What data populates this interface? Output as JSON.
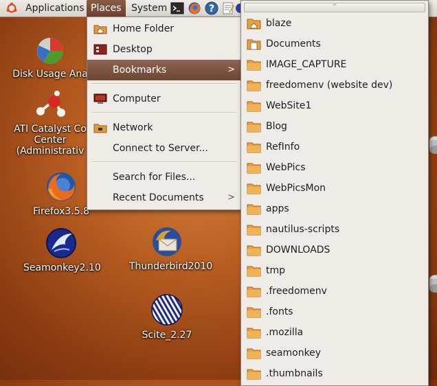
{
  "panel": {
    "applications": "Applications",
    "places": "Places",
    "system": "System"
  },
  "desktop": {
    "icons": [
      {
        "label1": "Disk Usage Ana",
        "label2": "",
        "label3": ""
      },
      {
        "label1": "ATI Catalyst Co",
        "label2": "Center",
        "label3": "(Administrativ"
      },
      {
        "label1": "Firefox3.5.8",
        "label2": "",
        "label3": ""
      },
      {
        "label1": "Seamonkey2.10",
        "label2": "",
        "label3": ""
      },
      {
        "label1": "Thunderbird2010",
        "label2": "",
        "label3": ""
      },
      {
        "label1": "Scite_2.27",
        "label2": "",
        "label3": ""
      }
    ]
  },
  "places_menu": {
    "items": [
      {
        "label": "Home Folder"
      },
      {
        "label": "Desktop"
      },
      {
        "label": "Bookmarks"
      },
      {
        "label": "Computer"
      },
      {
        "label": "Network"
      },
      {
        "label": "Connect to Server..."
      },
      {
        "label": "Search for Files..."
      },
      {
        "label": "Recent Documents"
      }
    ],
    "submenu_arrow": ">"
  },
  "bookmarks_menu": {
    "scroll_arrow": "^",
    "items": [
      "blaze",
      "Documents",
      "IMAGE_CAPTURE",
      "freedomenv (website dev)",
      "WebSite1",
      "Blog",
      "RefInfo",
      "WebPics",
      "WebPicsMon",
      "apps",
      "nautilus-scripts",
      "DOWNLOADS",
      "tmp",
      ".freedomenv",
      ".fonts",
      ".mozilla",
      "seamonkey",
      ".thumbnails"
    ]
  },
  "colors": {
    "highlight": "#7a4f3c",
    "folder": "#e8a040",
    "menu_bg": "#efebe7"
  }
}
